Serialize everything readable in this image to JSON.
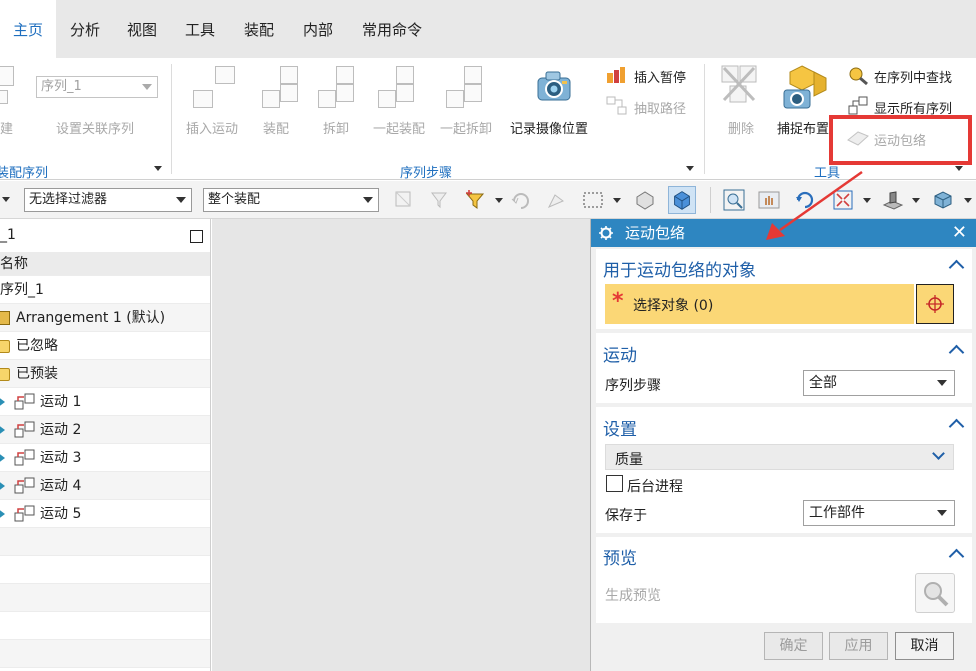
{
  "tabs": [
    "主页",
    "分析",
    "视图",
    "工具",
    "装配",
    "内部",
    "常用命令"
  ],
  "ribbon": {
    "sequence_combo": "序列_1",
    "build_partial": "建",
    "set_related_sequence": "设置关联序列",
    "insert_motion": "插入运动",
    "assemble": "装配",
    "disassemble": "拆卸",
    "assemble_together": "一起装配",
    "disassemble_together": "一起拆卸",
    "record_camera": "记录摄像位置",
    "insert_pause": "插入暂停",
    "extract_path": "抽取路径",
    "delete": "删除",
    "capture_layout": "捕捉布置",
    "find_in_sequence": "在序列中查找",
    "show_all_sequences": "显示所有序列",
    "motion_envelope": "运动包络",
    "group_assembly_sequence": "装配序列",
    "group_sequence_steps": "序列步骤",
    "group_tools": "工具"
  },
  "toolbar": {
    "filter": "无选择过滤器",
    "scope": "整个装配"
  },
  "navigator": {
    "title": "_1",
    "column_header": "名称",
    "rows": [
      "序列_1",
      "Arrangement 1 (默认)",
      "已忽略",
      "已预装",
      "运动 1",
      "运动 2",
      "运动 3",
      "运动 4",
      "运动 5"
    ]
  },
  "dialog": {
    "title": "运动包络",
    "objects_section": "用于运动包络的对象",
    "select_objects": "选择对象 (0)",
    "motion_section": "运动",
    "sequence_steps_label": "序列步骤",
    "sequence_steps_value": "全部",
    "settings_section": "设置",
    "quality_label": "质量",
    "background_process": "后台进程",
    "save_in_label": "保存于",
    "save_in_value": "工作部件",
    "preview_section": "预览",
    "generate_preview": "生成预览",
    "ok": "确定",
    "apply": "应用",
    "cancel": "取消"
  },
  "colors": {
    "accent_blue": "#2e86c1",
    "section_header": "#1f5fa8",
    "select_row": "#fbd776",
    "highlight_box": "#e53935",
    "required_star": "#e53935"
  }
}
